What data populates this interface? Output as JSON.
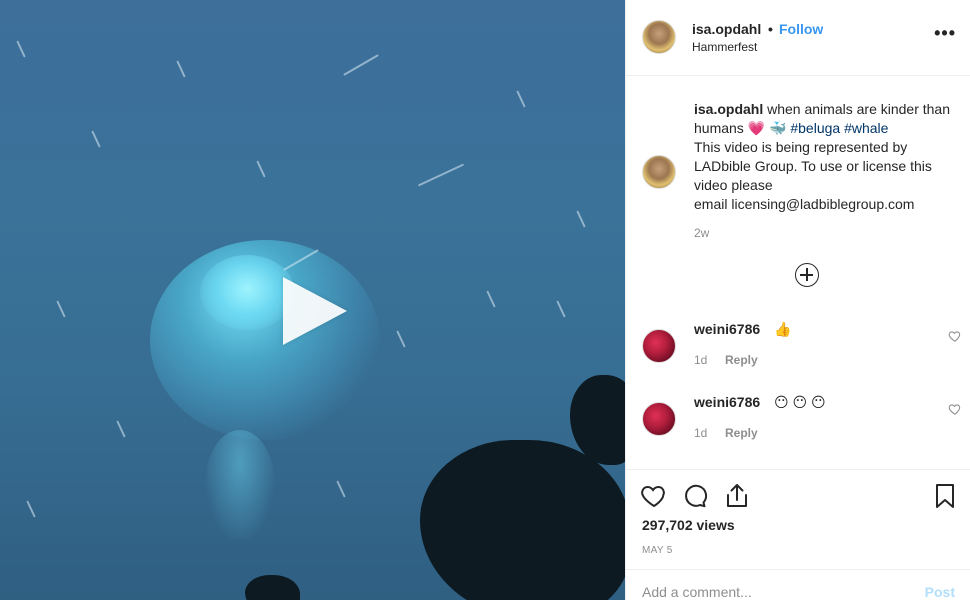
{
  "media": {
    "kind": "video"
  },
  "post_header": {
    "username": "isa.opdahl",
    "separator": "•",
    "follow_label": "Follow",
    "location": "Hammerfest",
    "more_label": "•••"
  },
  "caption": {
    "username": "isa.opdahl",
    "line1": "when animals are kinder than humans",
    "emojis": "💗 🐳",
    "tag1": "#beluga",
    "tag2": "#whale",
    "line2": "This video is being represented by LADbible Group. To use or license this video please",
    "line3": "email licensing@ladbiblegroup.com",
    "time": "2w"
  },
  "comments": [
    {
      "username": "weini6786",
      "text": "👍",
      "age": "1d",
      "reply_label": "Reply"
    },
    {
      "username": "weini6786",
      "text": "😶 😶 😶",
      "age": "1d",
      "reply_label": "Reply"
    }
  ],
  "stats": {
    "views": "297,702 views",
    "date": "MAY 5"
  },
  "add_comment": {
    "placeholder": "Add a comment...",
    "post_label": "Post"
  },
  "colors": {
    "accent": "#3897f0",
    "hashtag": "#003569",
    "post_disabled": "#b2dffc"
  }
}
